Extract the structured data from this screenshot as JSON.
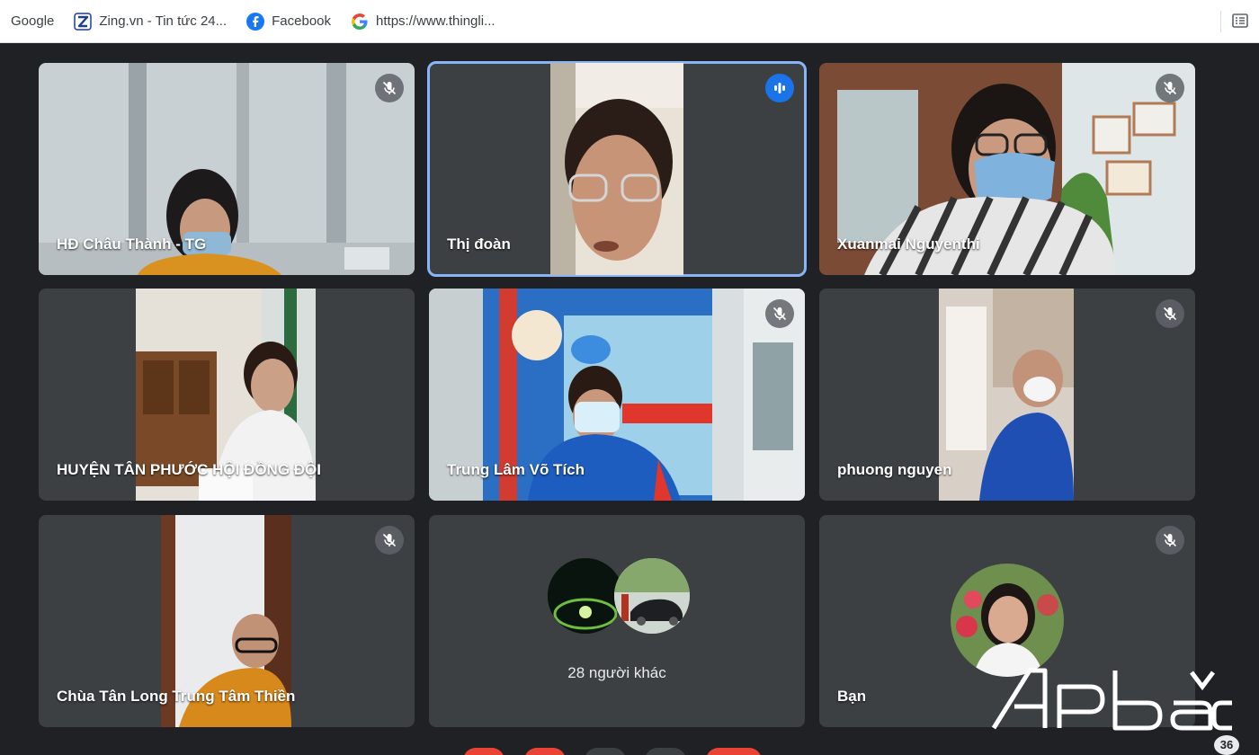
{
  "bookmarks": [
    {
      "label": "Google",
      "icon": "none"
    },
    {
      "label": "Zing.vn - Tin tức 24...",
      "icon": "zing-icon"
    },
    {
      "label": "Facebook",
      "icon": "facebook-icon"
    },
    {
      "label": "https://www.thingli...",
      "icon": "google-g-icon"
    }
  ],
  "participants": [
    {
      "name": "HĐ Châu Thành - TG",
      "muted": true
    },
    {
      "name": "Thị đoàn",
      "muted": false,
      "speaking": true
    },
    {
      "name": "Xuanmai Nguyenthi",
      "muted": true
    },
    {
      "name": "HUYỆN TÂN PHƯỚC HỘI ĐỒNG ĐỘI",
      "muted": false
    },
    {
      "name": "Trung Lâm Võ Tích",
      "muted": true
    },
    {
      "name": "phuong nguyen",
      "muted": true
    },
    {
      "name": "Chùa Tân Long Trung Tâm Thiền",
      "muted": true
    },
    {
      "name": "Bạn",
      "muted": true
    }
  ],
  "others": {
    "label": "28 người khác"
  },
  "participant_count": "36",
  "watermark": {
    "text": "Apbac"
  },
  "colors": {
    "background": "#202124",
    "tile": "#3c4043",
    "speaking_border": "#8ab4f8",
    "active_mic": "#1a73e8"
  }
}
